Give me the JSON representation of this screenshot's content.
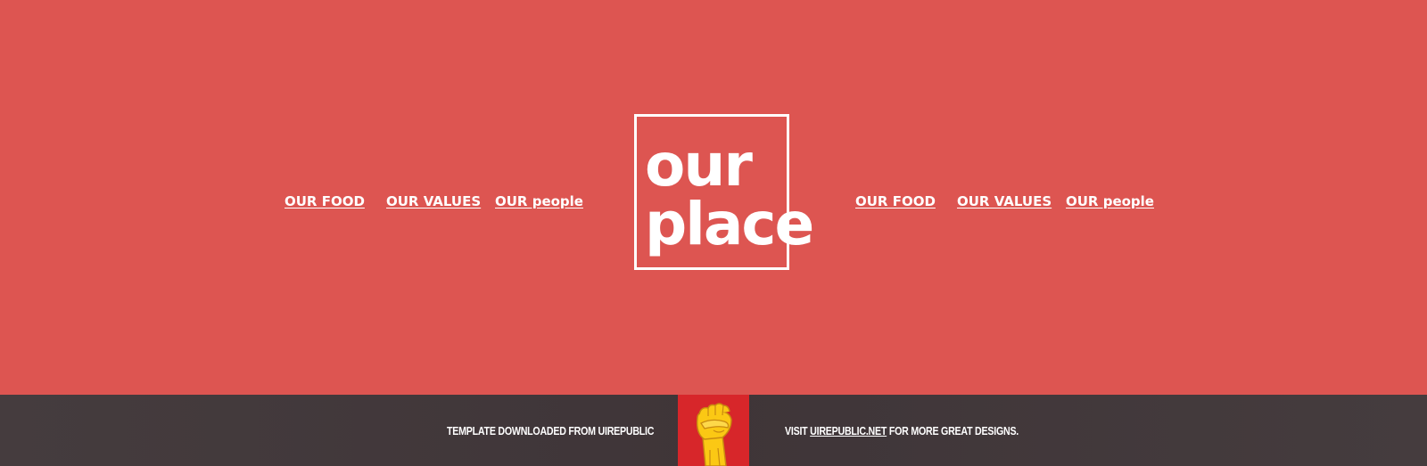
{
  "nav_left": [
    {
      "label": "OUR FOOD"
    },
    {
      "label": "OUR VALUES"
    },
    {
      "label": "OUR people"
    }
  ],
  "nav_right": [
    {
      "label": "OUR FOOD"
    },
    {
      "label": "OUR VALUES"
    },
    {
      "label": "OUR people"
    }
  ],
  "logo": {
    "line1": "our",
    "line2": "place"
  },
  "footer": {
    "left_text": "TEMPLATE DOWNLOADED FROM UIREPUBLIC",
    "visit_prefix": "VISIT",
    "visit_link": "UIREPUBLIC.NET",
    "visit_suffix": "FOR MORE GREAT DESIGNS."
  },
  "colors": {
    "hero_bg": "#dd5551",
    "footer_bg": "#423a3c",
    "badge_bg": "#d7262a",
    "fist": "#fbc814"
  },
  "icons": {
    "badge": "raised-fist-icon"
  }
}
